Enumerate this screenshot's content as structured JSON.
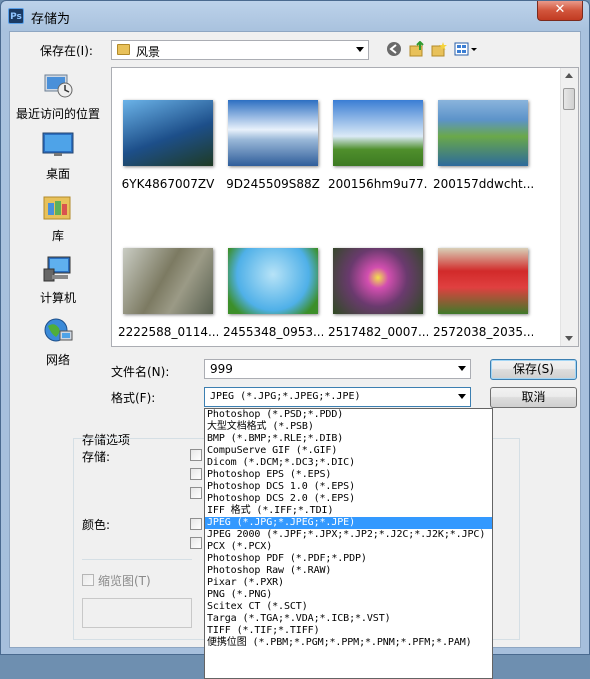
{
  "window": {
    "title": "存储为",
    "app_icon": "Ps",
    "close_glyph": "✕"
  },
  "toolbar": {
    "save_in_label": "保存在(I):",
    "save_in_value": "风景"
  },
  "places": [
    {
      "name": "recent",
      "label": "最近访问的位置"
    },
    {
      "name": "desktop",
      "label": "桌面"
    },
    {
      "name": "library",
      "label": "库"
    },
    {
      "name": "computer",
      "label": "计算机"
    },
    {
      "name": "network",
      "label": "网络"
    }
  ],
  "files": [
    {
      "label": "6YK4867007ZV",
      "colors": [
        "#1d4f8a",
        "#6bb3e8",
        "#1f3b24"
      ]
    },
    {
      "label": "9D245509S88Z",
      "colors": [
        "#2d6fc2",
        "#e8f1fb",
        "#2f5d9a"
      ]
    },
    {
      "label": "200156hm9u77...",
      "colors": [
        "#3a7ed4",
        "#dbeaf7",
        "#4f8f2c"
      ]
    },
    {
      "label": "200157ddwcht...",
      "colors": [
        "#5c93c9",
        "#6aa84a",
        "#2d6a9c"
      ]
    },
    {
      "label": "2222588_0114...",
      "colors": [
        "#c9ccc3",
        "#7c7a62",
        "#586050"
      ]
    },
    {
      "label": "2455348_0953...",
      "colors": [
        "#4fb0e8",
        "#b7e3f7",
        "#3c8f2a"
      ]
    },
    {
      "label": "2517482_0007...",
      "colors": [
        "#6a3a6e",
        "#d34fb0",
        "#2f4a22"
      ]
    },
    {
      "label": "2572038_2035...",
      "colors": [
        "#d8d0b8",
        "#d22a2a",
        "#3f7a2a"
      ]
    }
  ],
  "form": {
    "filename_label": "文件名(N):",
    "filename_value": "999",
    "format_label": "格式(F):",
    "format_value": "JPEG (*.JPG;*.JPEG;*.JPE)",
    "save_button": "保存(S)",
    "cancel_button": "取消"
  },
  "options": {
    "group_title": "存储选项",
    "storage_label": "存储:",
    "color_label": "颜色:",
    "thumbnail_label": "缩览图(T)"
  },
  "format_list": [
    "Photoshop (*.PSD;*.PDD)",
    "大型文档格式 (*.PSB)",
    "BMP (*.BMP;*.RLE;*.DIB)",
    "CompuServe GIF (*.GIF)",
    "Dicom (*.DCM;*.DC3;*.DIC)",
    "Photoshop EPS (*.EPS)",
    "Photoshop DCS 1.0 (*.EPS)",
    "Photoshop DCS 2.0 (*.EPS)",
    "IFF 格式 (*.IFF;*.TDI)",
    "JPEG (*.JPG;*.JPEG;*.JPE)",
    "JPEG 2000 (*.JPF;*.JPX;*.JP2;*.J2C;*.J2K;*.JPC)",
    "PCX (*.PCX)",
    "Photoshop PDF (*.PDF;*.PDP)",
    "Photoshop Raw (*.RAW)",
    "Pixar (*.PXR)",
    "PNG (*.PNG)",
    "Scitex CT (*.SCT)",
    "Targa (*.TGA;*.VDA;*.ICB;*.VST)",
    "TIFF (*.TIF;*.TIFF)",
    "便携位图 (*.PBM;*.PGM;*.PPM;*.PNM;*.PFM;*.PAM)"
  ],
  "format_list_selected": "JPEG (*.JPG;*.JPEG;*.JPE)",
  "colors": {
    "selection": "#3399ff",
    "title_bar": "#b5cce8"
  }
}
